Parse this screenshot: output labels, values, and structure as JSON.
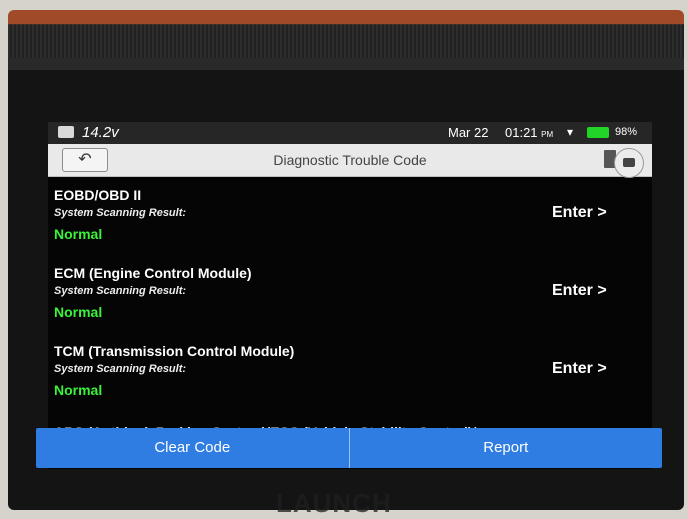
{
  "status": {
    "voltage": "14.2v",
    "date": "Mar 22",
    "time": "01:21",
    "ampm": "PM",
    "battery": "98%"
  },
  "header": {
    "back_icon": "back-arrow-icon",
    "title": "Diagnostic Trouble Code"
  },
  "items": [
    {
      "name": "EOBD/OBD II",
      "sub": "System Scanning Result:",
      "result": "Normal",
      "action": "Enter >"
    },
    {
      "name": "ECM (Engine Control Module)",
      "sub": "System Scanning Result:",
      "result": "Normal",
      "action": "Enter >"
    },
    {
      "name": "TCM (Transmission Control Module)",
      "sub": "System Scanning Result:",
      "result": "Normal",
      "action": "Enter >"
    }
  ],
  "partial_item": {
    "name": "ABS (Anti-lock Braking System)/ESC (Vehicle Stability Control)/"
  },
  "footer": {
    "clear": "Clear Code",
    "report": "Report"
  },
  "brand": "LAUNCH",
  "colors": {
    "accent": "#2f7de2",
    "normal": "#3af23a",
    "battery": "#22d428"
  }
}
